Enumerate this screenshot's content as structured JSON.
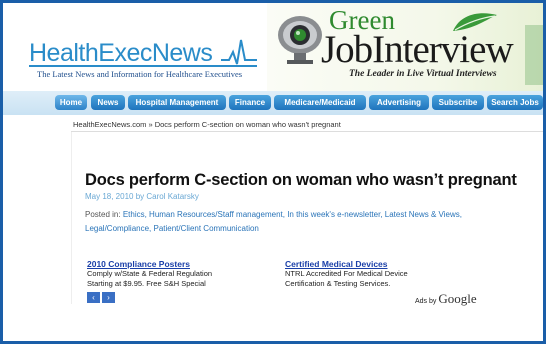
{
  "header": {
    "logo_health": "HealthExecNews",
    "logo_tagline": "The Latest News and Information for Healthcare Executives"
  },
  "ad_banner": {
    "brand_small": "Green",
    "brand_main": "JobInterview",
    "tagline": "The Leader in Live Virtual Interviews"
  },
  "nav": {
    "tabs": [
      {
        "label": "Home"
      },
      {
        "label": "News"
      },
      {
        "label": "Hospital Management"
      },
      {
        "label": "Finance"
      },
      {
        "label": "Medicare/Medicaid"
      },
      {
        "label": "Advertising"
      },
      {
        "label": "Subscribe"
      },
      {
        "label": "Search Jobs"
      }
    ]
  },
  "breadcrumb": "HealthExecNews.com » Docs perform C-section on woman who wasn't pregnant",
  "article": {
    "title": "Docs perform C-section on woman who wasn’t pregnant",
    "meta": "May 18, 2010 by Carol Katarsky",
    "posted_prefix": "Posted in:",
    "categories_line1": "Ethics, Human Resources/Staff management, In this week's e-newsletter, Latest News & Views,",
    "categories_line2": "Legal/Compliance, Patient/Client Communication"
  },
  "ads": {
    "ad1": {
      "title": "2010 Compliance Posters",
      "line1": "Comply w/State & Federal Regulation",
      "line2": "Starting at $9.95. Free S&H Special"
    },
    "ad2": {
      "title": "Certified Medical Devices",
      "line1": "NTRL Accredited For Medical Device",
      "line2": "Certification & Testing Services."
    },
    "ads_by": "Ads by",
    "google": "Google",
    "pager_prev": "‹",
    "pager_next": "›"
  }
}
